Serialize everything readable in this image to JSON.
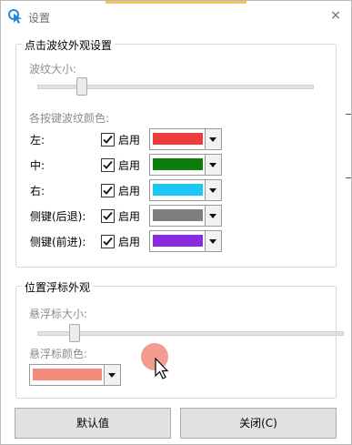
{
  "window": {
    "title": "设置",
    "close_symbol": "×"
  },
  "ripple_group": {
    "title": "点击波纹外观设置",
    "size_label": "波纹大小:",
    "size_value_percent": 15,
    "colors_label": "各按键波纹颜色:",
    "rows": [
      {
        "label": "左:",
        "enabled": true,
        "enable_label": "启用",
        "color": "#ee3c3c"
      },
      {
        "label": "中:",
        "enabled": true,
        "enable_label": "启用",
        "color": "#0a7d0a"
      },
      {
        "label": "右:",
        "enabled": true,
        "enable_label": "启用",
        "color": "#1cc7f5"
      },
      {
        "label": "侧键(后退):",
        "enabled": true,
        "enable_label": "启用",
        "color": "#7e7e7e"
      },
      {
        "label": "侧键(前进):",
        "enabled": true,
        "enable_label": "启用",
        "color": "#8a2be2"
      }
    ]
  },
  "hover_group": {
    "title": "位置浮标外观",
    "size_label": "悬浮标大小:",
    "size_value_percent": 12,
    "color_label": "悬浮标颜色:",
    "color": "#f38c7c"
  },
  "buttons": {
    "default": "默认值",
    "close": "关闭(C)"
  }
}
